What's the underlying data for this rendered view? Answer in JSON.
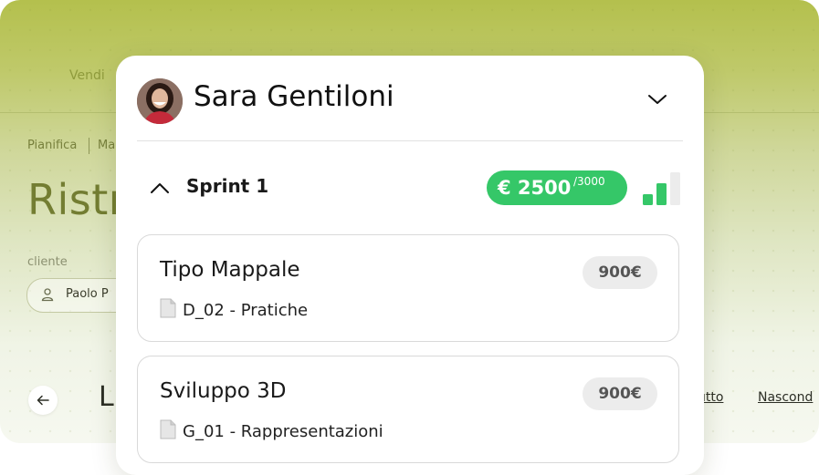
{
  "background": {
    "nav_item": "Vendi",
    "breadcrumb": [
      "Pianifica",
      "Ma"
    ],
    "page_title": "Ristr",
    "client_label": "cliente",
    "client_chip": "Paolo P",
    "section_heading": "L",
    "links": [
      "utto",
      "Nascond"
    ]
  },
  "panel": {
    "user_name": "Sara Gentiloni",
    "sprint": {
      "label": "Sprint 1",
      "budget_value": "€ 2500",
      "budget_max": "/3000",
      "signal_level": 2,
      "signal_max": 3
    },
    "tasks": [
      {
        "title": "Tipo Mappale",
        "price": "900€",
        "doc": "D_02 - Pratiche"
      },
      {
        "title": "Sviluppo 3D",
        "price": "900€",
        "doc": "G_01 - Rappresentazioni"
      }
    ]
  },
  "colors": {
    "accent_green": "#35c768",
    "background_olive": "#b4c04d"
  },
  "icons": [
    "user-icon",
    "arrow-left-icon",
    "chevron-down-icon",
    "chevron-up-icon",
    "signal-bars-icon",
    "document-icon"
  ]
}
